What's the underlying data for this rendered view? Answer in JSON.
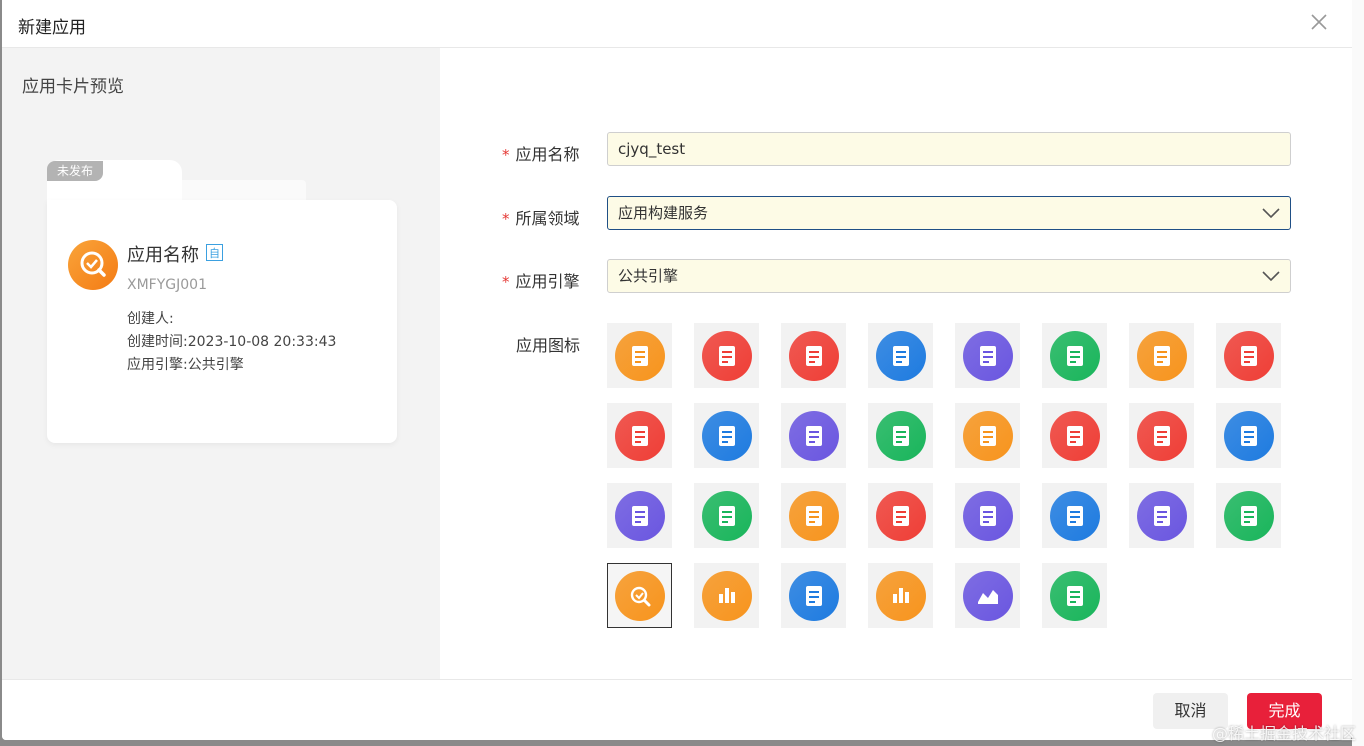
{
  "dialog": {
    "title": "新建应用"
  },
  "preview": {
    "title": "应用卡片预览",
    "status_badge": "未发布",
    "card": {
      "name": "应用名称",
      "tag": "自",
      "code": "XMFYGJ001",
      "creator": "创建人:",
      "created_time": "创建时间:2023-10-08 20:33:43",
      "engine": "应用引擎:公共引擎"
    }
  },
  "form": {
    "name": {
      "label": "应用名称",
      "value": "cjyq_test"
    },
    "domain": {
      "label": "所属领域",
      "value": "应用构建服务"
    },
    "engine": {
      "label": "应用引擎",
      "value": "公共引擎"
    },
    "icon": {
      "label": "应用图标"
    },
    "required_mark": "*"
  },
  "icons": [
    {
      "icon": "toolbox",
      "color": "#f7941d",
      "selected": false
    },
    {
      "icon": "monitor-gear",
      "color": "#ef3e36",
      "selected": false
    },
    {
      "icon": "clipboard-edit",
      "color": "#ef3e36",
      "selected": false
    },
    {
      "icon": "chat-gear",
      "color": "#1e7be0",
      "selected": false
    },
    {
      "icon": "clipboard-check",
      "color": "#6a56e0",
      "selected": false
    },
    {
      "icon": "folder-gear",
      "color": "#19b55b",
      "selected": false
    },
    {
      "icon": "clipboard-add",
      "color": "#f7941d",
      "selected": false
    },
    {
      "icon": "box",
      "color": "#ef3e36",
      "selected": false
    },
    {
      "icon": "chart-report",
      "color": "#ef3e36",
      "selected": false
    },
    {
      "icon": "clipboard-list",
      "color": "#1e7be0",
      "selected": false
    },
    {
      "icon": "briefcase",
      "color": "#6a56e0",
      "selected": false
    },
    {
      "icon": "book",
      "color": "#19b55b",
      "selected": false
    },
    {
      "icon": "clipboard-plus",
      "color": "#f7941d",
      "selected": false
    },
    {
      "icon": "box",
      "color": "#ef3e36",
      "selected": false
    },
    {
      "icon": "cabinet",
      "color": "#ef3e36",
      "selected": false
    },
    {
      "icon": "doc-user",
      "color": "#1e7be0",
      "selected": false
    },
    {
      "icon": "doc-bookmark",
      "color": "#6a56e0",
      "selected": false
    },
    {
      "icon": "window",
      "color": "#19b55b",
      "selected": false
    },
    {
      "icon": "document",
      "color": "#f7941d",
      "selected": false
    },
    {
      "icon": "doc-pie",
      "color": "#ef3e36",
      "selected": false
    },
    {
      "icon": "tray",
      "color": "#6a56e0",
      "selected": false
    },
    {
      "icon": "doc-check",
      "color": "#1e7be0",
      "selected": false
    },
    {
      "icon": "doc-gear",
      "color": "#6a56e0",
      "selected": false
    },
    {
      "icon": "notebook",
      "color": "#19b55b",
      "selected": false
    },
    {
      "icon": "search-check",
      "color": "#f7941d",
      "selected": true
    },
    {
      "icon": "bar-chart",
      "color": "#f7941d",
      "selected": false
    },
    {
      "icon": "doc-edit",
      "color": "#1e7be0",
      "selected": false
    },
    {
      "icon": "bar-chart",
      "color": "#f7941d",
      "selected": false
    },
    {
      "icon": "area-chart",
      "color": "#6a56e0",
      "selected": false
    },
    {
      "icon": "note",
      "color": "#19b55b",
      "selected": false
    }
  ],
  "footer": {
    "cancel_label": "取消",
    "ok_label": "完成"
  },
  "watermark": "@稀土掘金技术社区"
}
